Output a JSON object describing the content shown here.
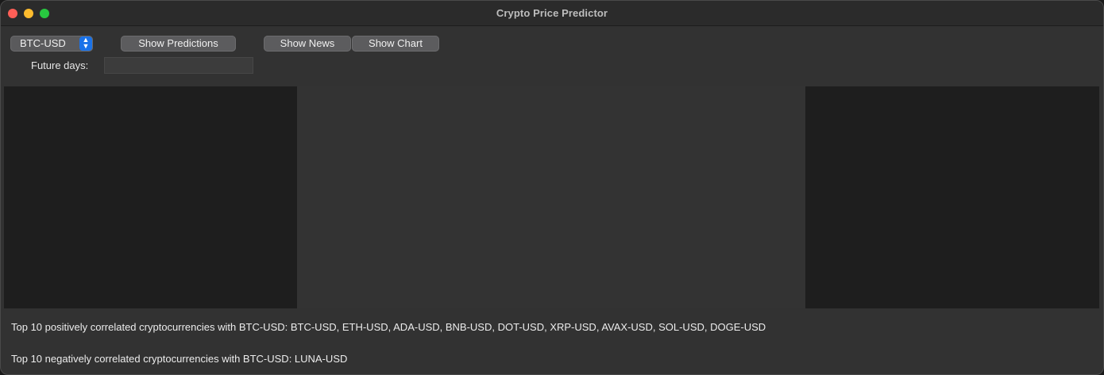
{
  "window": {
    "title": "Crypto Price Predictor"
  },
  "toolbar": {
    "symbol_selected": "BTC-USD",
    "show_predictions_label": "Show Predictions",
    "show_news_label": "Show News",
    "show_chart_label": "Show Chart"
  },
  "future_days": {
    "label": "Future days:",
    "value": ""
  },
  "correlations": {
    "positive_text": "Top 10 positively correlated cryptocurrencies with BTC-USD: BTC-USD, ETH-USD, ADA-USD, BNB-USD, DOT-USD, XRP-USD, AVAX-USD, SOL-USD, DOGE-USD",
    "negative_text": "Top 10 negatively correlated cryptocurrencies with BTC-USD: LUNA-USD"
  },
  "colors": {
    "accent": "#1a72e8",
    "close": "#ff5f57",
    "minimize": "#febc2e",
    "maximize": "#28c840"
  }
}
